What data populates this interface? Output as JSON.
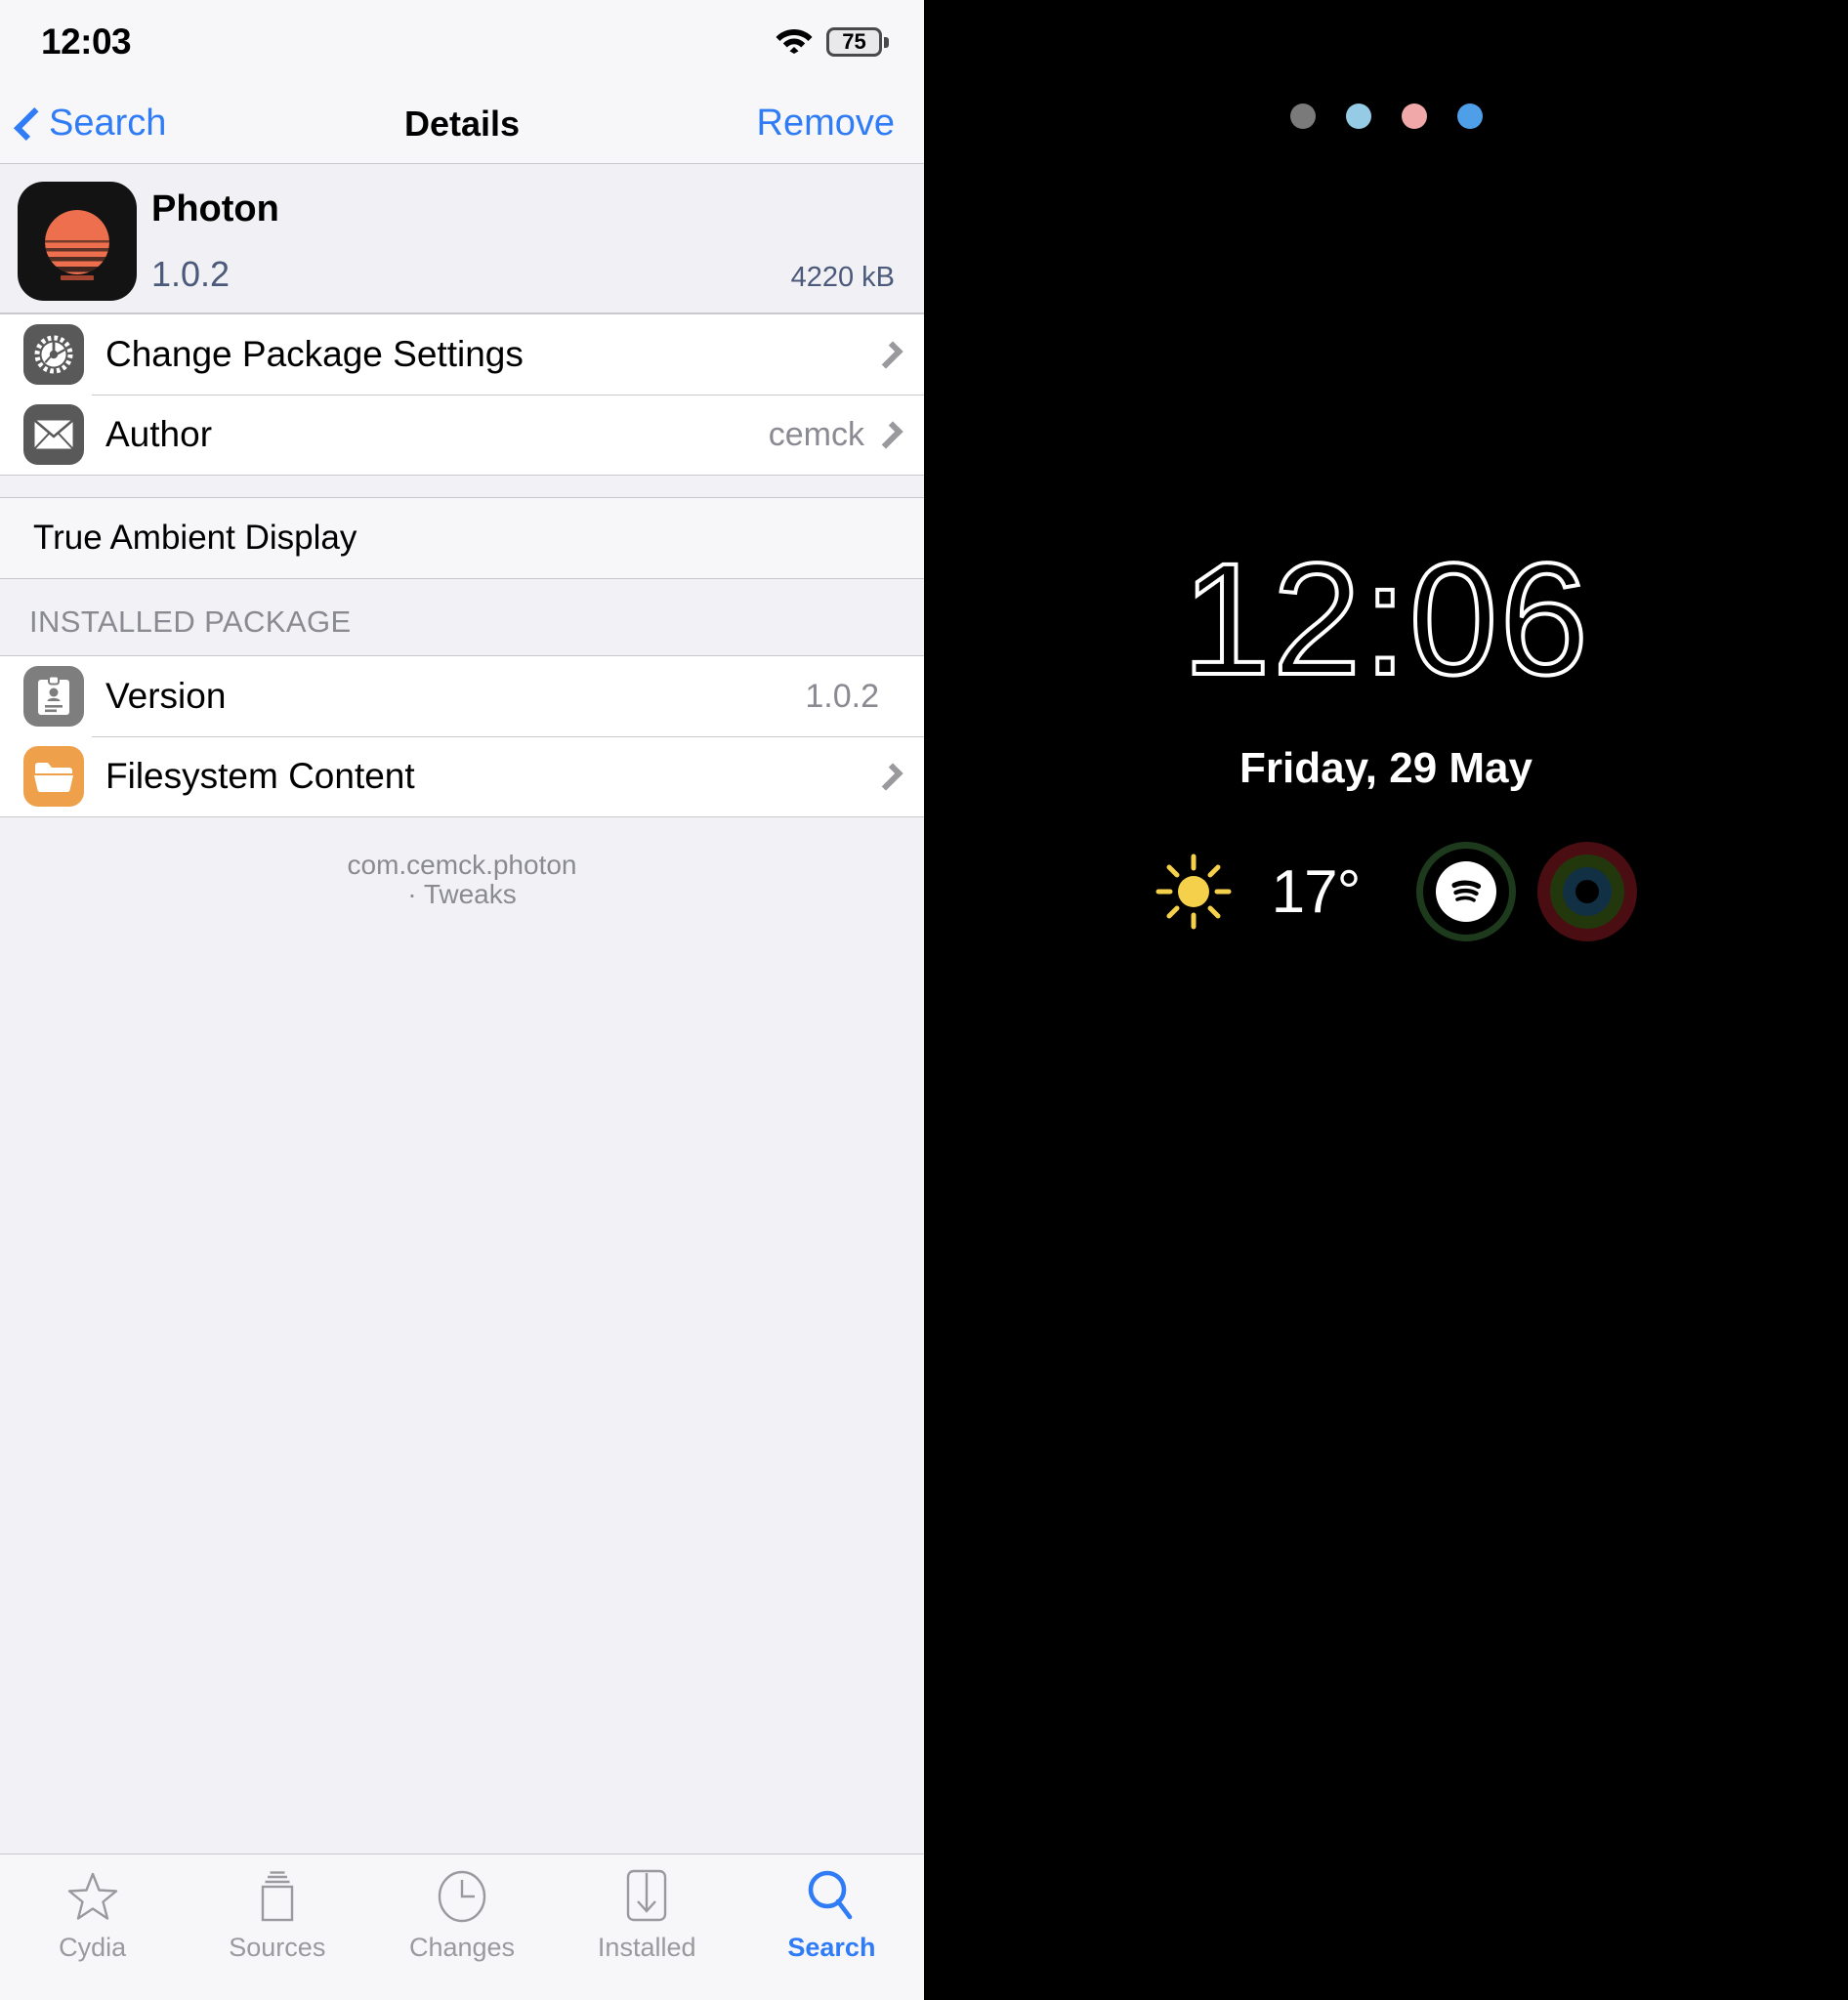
{
  "left": {
    "statusbar": {
      "time": "12:03",
      "wifi_icon": "wifi-icon",
      "battery_percent": "75"
    },
    "navbar": {
      "back_label": "Search",
      "title": "Details",
      "action_label": "Remove"
    },
    "package": {
      "name": "Photon",
      "version": "1.0.2",
      "size": "4220 kB",
      "icon_name": "photon-app-icon"
    },
    "actions": [
      {
        "icon": "gear-icon",
        "label": "Change Package Settings",
        "value": "",
        "chevron": true
      },
      {
        "icon": "envelope-icon",
        "label": "Author",
        "value": "cemck",
        "chevron": true
      }
    ],
    "description": "True Ambient Display",
    "installed_section": {
      "header": "INSTALLED PACKAGE",
      "rows": [
        {
          "icon": "id-card-icon",
          "label": "Version",
          "value": "1.0.2",
          "chevron": false
        },
        {
          "icon": "folder-icon",
          "label": "Filesystem Content",
          "value": "",
          "chevron": true
        }
      ]
    },
    "footer": {
      "identifier": "com.cemck.photon",
      "section": "· Tweaks"
    },
    "tabs": [
      {
        "icon": "star-icon",
        "label": "Cydia",
        "active": false
      },
      {
        "icon": "stack-icon",
        "label": "Sources",
        "active": false
      },
      {
        "icon": "clock-icon",
        "label": "Changes",
        "active": false
      },
      {
        "icon": "download-box-icon",
        "label": "Installed",
        "active": false
      },
      {
        "icon": "search-icon",
        "label": "Search",
        "active": true
      }
    ],
    "colors": {
      "accent": "#2f7cf6",
      "row_bg": "#ffffff",
      "page_bg": "#f2f2f6",
      "separator": "#c9c9cd",
      "secondary_text": "#8a8a92",
      "version_text": "#4b5a7a",
      "icon_gray": "#595959",
      "icon_gray_light": "#7e7e7e",
      "icon_orange": "#efa04a"
    }
  },
  "right": {
    "dots": [
      {
        "name": "page-dot-1",
        "color": "#7a7a7a"
      },
      {
        "name": "page-dot-2",
        "color": "#96cbe5"
      },
      {
        "name": "page-dot-3",
        "color": "#f0a8a8"
      },
      {
        "name": "page-dot-4",
        "color": "#4f9ee8"
      }
    ],
    "clock": "12:06",
    "date": "Friday, 29 May",
    "weather": {
      "icon": "sun-icon",
      "temperature": "17°"
    },
    "widgets": [
      {
        "name": "spotify-widget",
        "icon": "spotify-icon",
        "ring_color": "#1d3a1d"
      },
      {
        "name": "activity-rings-widget",
        "icon": "activity-rings-icon",
        "ring_outer": "#4a0d12",
        "ring_middle": "#22380c",
        "ring_inner": "#113044"
      }
    ],
    "colors": {
      "background": "#000000",
      "text": "#ffffff",
      "sun": "#f5d04a"
    }
  }
}
